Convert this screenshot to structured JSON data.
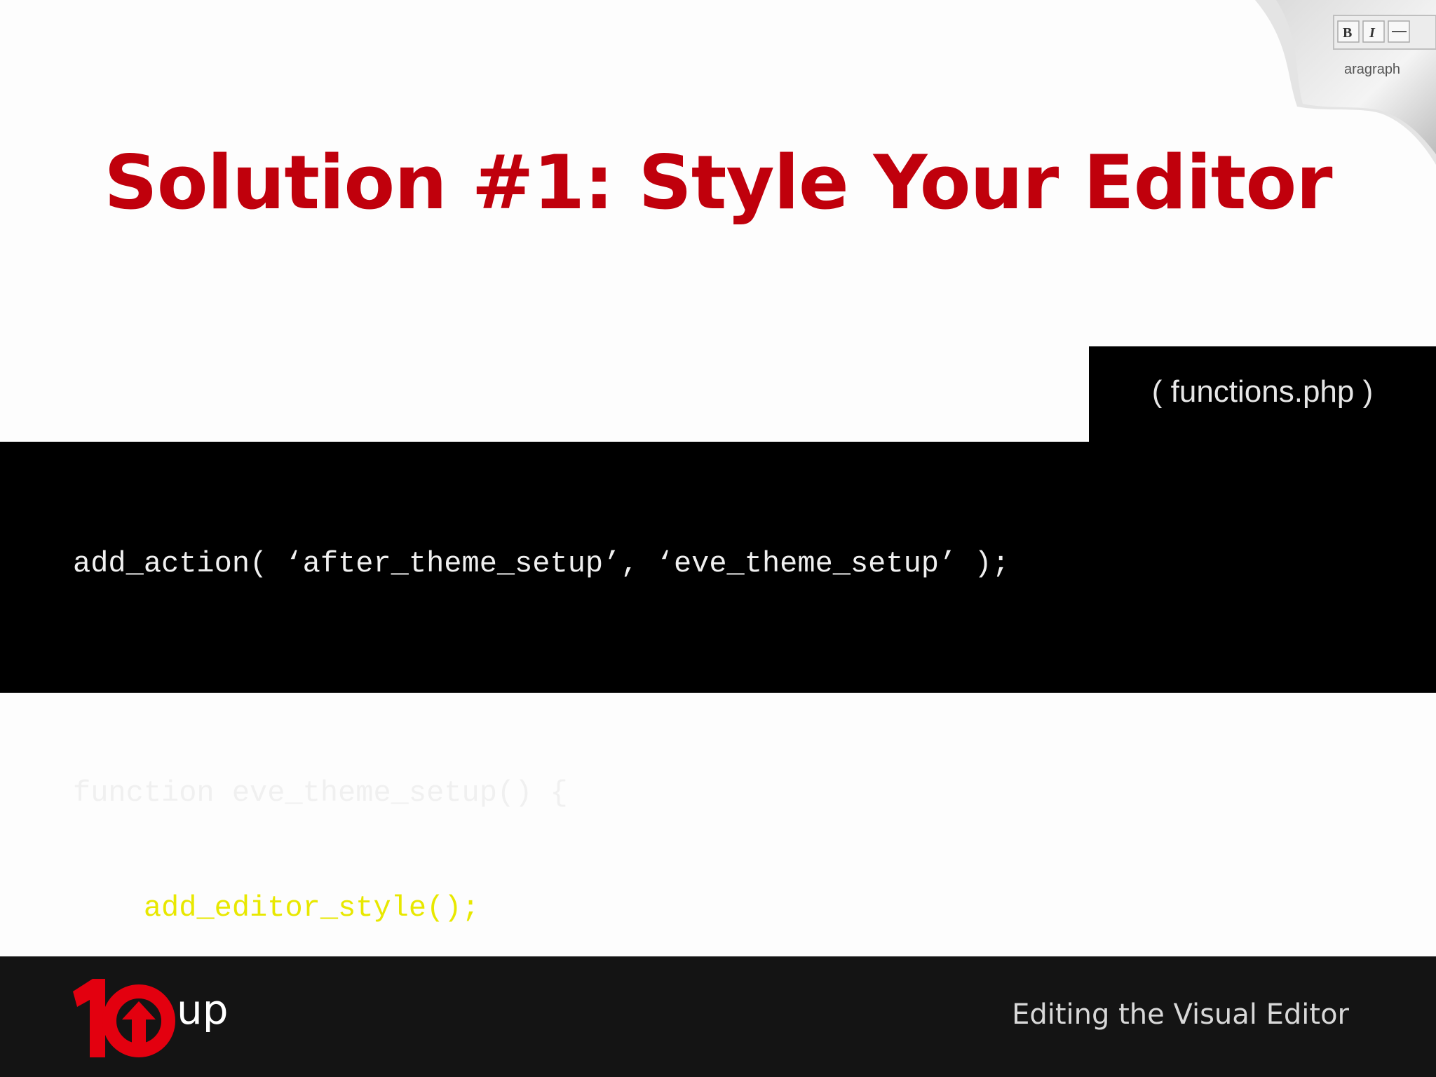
{
  "slide": {
    "title": "Solution #1: Style Your Editor",
    "file_label": "( functions.php )",
    "code": {
      "line1": "add_action( ‘after_theme_setup’, ‘eve_theme_setup’ );",
      "line2": "function eve_theme_setup() {",
      "line3_indent": "    ",
      "line3": "add_editor_style();",
      "line4": "}"
    },
    "footer_text": "Editing the Visual Editor",
    "curl_label": "aragraph"
  },
  "logo": {
    "number": "10",
    "suffix": "up"
  },
  "colors": {
    "title": "#c0000c",
    "code_highlight": "#e8e800",
    "logo_red": "#e3000f"
  },
  "icons": {
    "editor_thumbnail": "page-curl-icon",
    "bold": "bold-icon",
    "italic": "italic-icon",
    "logo": "10up-logo"
  }
}
